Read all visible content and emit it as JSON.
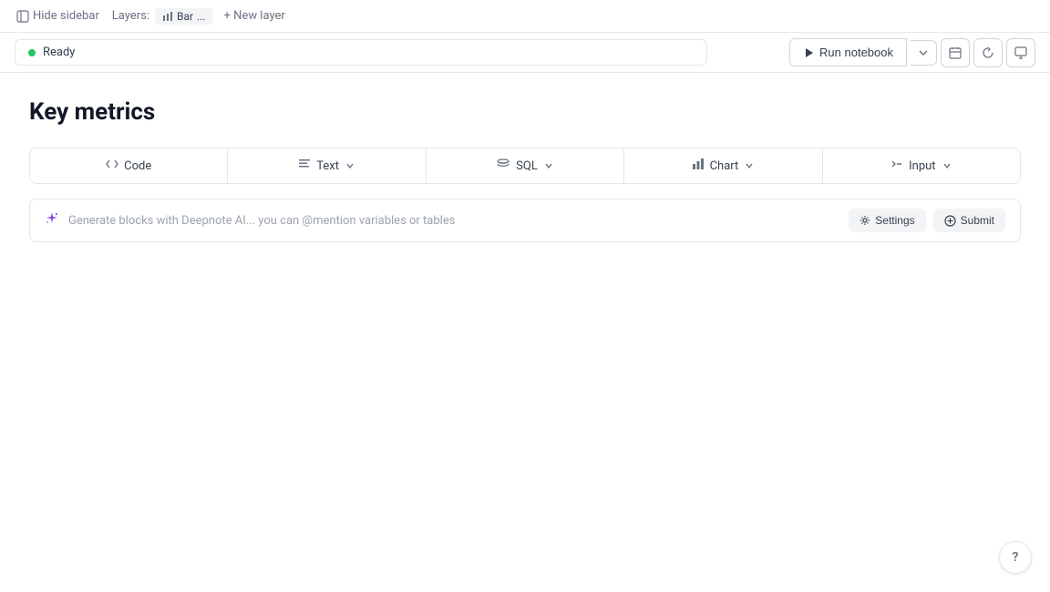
{
  "topbar": {
    "hide_sidebar_label": "Hide sidebar",
    "layers_label": "Layers:",
    "layers_chip_label": "Bar",
    "layers_more": "...",
    "new_layer_label": "+ New layer"
  },
  "statusbar": {
    "ready_label": "Ready",
    "run_notebook_label": "Run notebook",
    "ready_dot_color": "#22c55e"
  },
  "main": {
    "page_title": "Key metrics",
    "block_types": [
      {
        "id": "code",
        "label": "Code",
        "icon": "code"
      },
      {
        "id": "text",
        "label": "Text",
        "icon": "text",
        "has_chevron": true
      },
      {
        "id": "sql",
        "label": "SQL",
        "icon": "sql",
        "has_chevron": true
      },
      {
        "id": "chart",
        "label": "Chart",
        "icon": "chart",
        "has_chevron": true
      },
      {
        "id": "input",
        "label": "Input",
        "icon": "input",
        "has_chevron": true
      }
    ],
    "ai_bar": {
      "placeholder": "Generate blocks with Deepnote AI... you can @mention variables or tables",
      "settings_label": "Settings",
      "submit_label": "Submit"
    }
  },
  "help": {
    "label": "?"
  }
}
